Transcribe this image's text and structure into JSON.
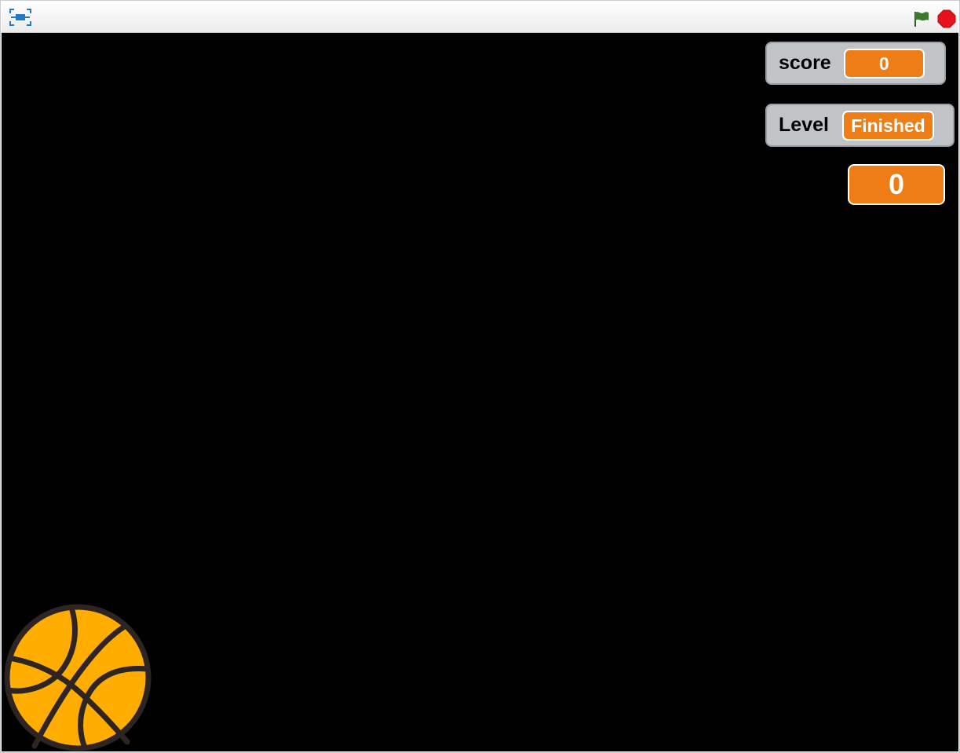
{
  "toolbar": {
    "fullscreen_icon": "fullscreen-icon",
    "green_flag_icon": "green-flag-icon",
    "stop_icon": "stop-sign-icon"
  },
  "stage": {
    "background_color": "#000000",
    "monitors": {
      "score": {
        "label": "score",
        "value": "0"
      },
      "level": {
        "label": "Level",
        "value": "Finished"
      }
    },
    "large_readout": {
      "value": "0"
    },
    "sprite": {
      "name": "basketball",
      "icon": "basketball-icon"
    }
  },
  "colors": {
    "monitor_value": "#ee7d16",
    "monitor_bg": "#c1c4c7",
    "flag": "#3d7a2f",
    "stop": "#e6111c",
    "fullscreen": "#1f7bc9",
    "ball": "#ffad00",
    "ball_lines": "#2e2523"
  }
}
